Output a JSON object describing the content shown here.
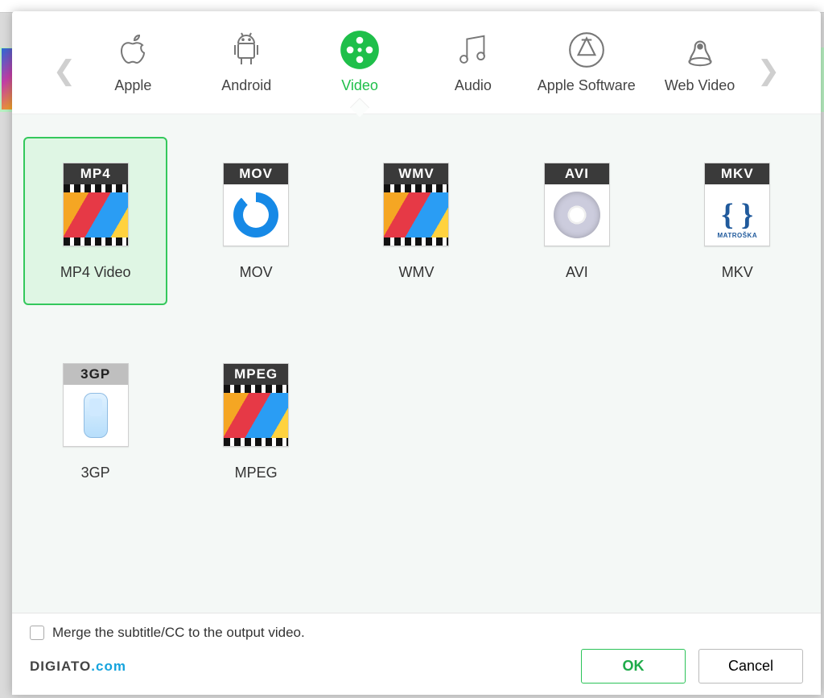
{
  "categories": [
    {
      "id": "apple",
      "label": "Apple"
    },
    {
      "id": "android",
      "label": "Android"
    },
    {
      "id": "video",
      "label": "Video",
      "active": true
    },
    {
      "id": "audio",
      "label": "Audio"
    },
    {
      "id": "apple-software",
      "label": "Apple Software"
    },
    {
      "id": "web-video",
      "label": "Web Video"
    }
  ],
  "formats": [
    {
      "id": "mp4",
      "badge": "MP4",
      "label": "MP4 Video",
      "selected": true,
      "body": "movie"
    },
    {
      "id": "mov",
      "badge": "MOV",
      "label": "MOV",
      "body": "mov"
    },
    {
      "id": "wmv",
      "badge": "WMV",
      "label": "WMV",
      "body": "movie"
    },
    {
      "id": "avi",
      "badge": "AVI",
      "label": "AVI",
      "body": "avi"
    },
    {
      "id": "mkv",
      "badge": "MKV",
      "label": "MKV",
      "body": "mkv"
    },
    {
      "id": "3gp",
      "badge": "3GP",
      "label": "3GP",
      "body": "3gp",
      "badgeLight": true
    },
    {
      "id": "mpeg",
      "badge": "MPEG",
      "label": "MPEG",
      "body": "movie"
    }
  ],
  "merge_label": "Merge the subtitle/CC to the output video.",
  "merge_checked": false,
  "brand_part1": "DIGIATO",
  "brand_part2": ".com",
  "buttons": {
    "ok": "OK",
    "cancel": "Cancel"
  }
}
